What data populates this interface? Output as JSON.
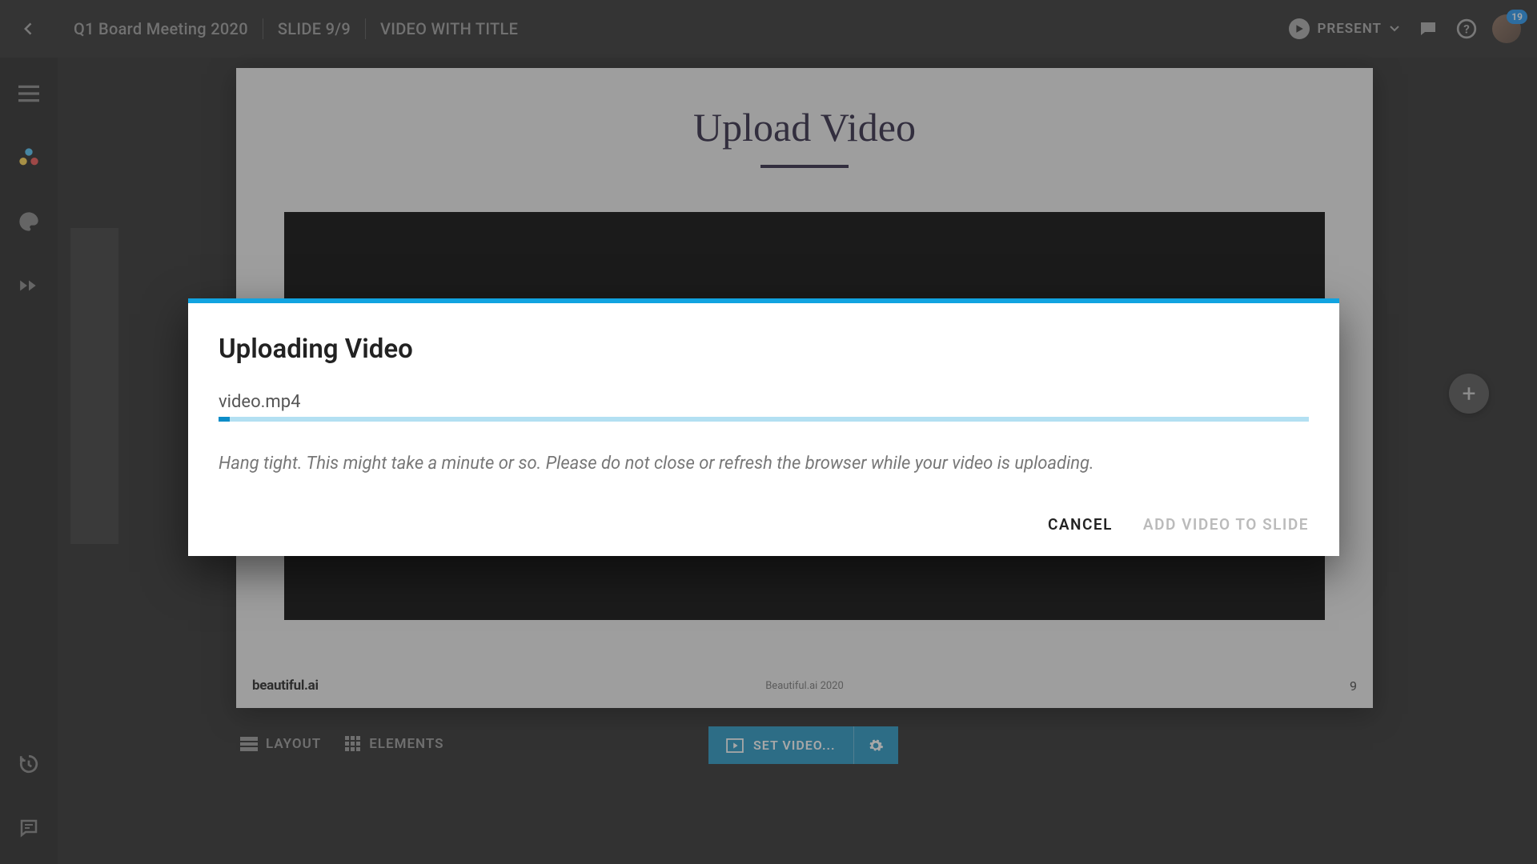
{
  "header": {
    "deck_title": "Q1 Board Meeting 2020",
    "slide_indicator": "SLIDE 9/9",
    "template_name": "VIDEO WITH TITLE",
    "present_label": "PRESENT",
    "notification_count": "19"
  },
  "slide": {
    "title": "Upload Video",
    "brand": "beautiful.ai",
    "footer_center": "Beautiful.ai 2020",
    "page_number": "9"
  },
  "toolbar": {
    "layout_label": "LAYOUT",
    "elements_label": "ELEMENTS",
    "set_video_label": "SET VIDEO..."
  },
  "modal": {
    "title": "Uploading Video",
    "filename": "video.mp4",
    "hint": "Hang tight. This might take a minute or so. Please do not close or refresh the browser while your video is uploading.",
    "cancel_label": "CANCEL",
    "add_label": "ADD VIDEO TO SLIDE",
    "progress_percent": 1
  }
}
